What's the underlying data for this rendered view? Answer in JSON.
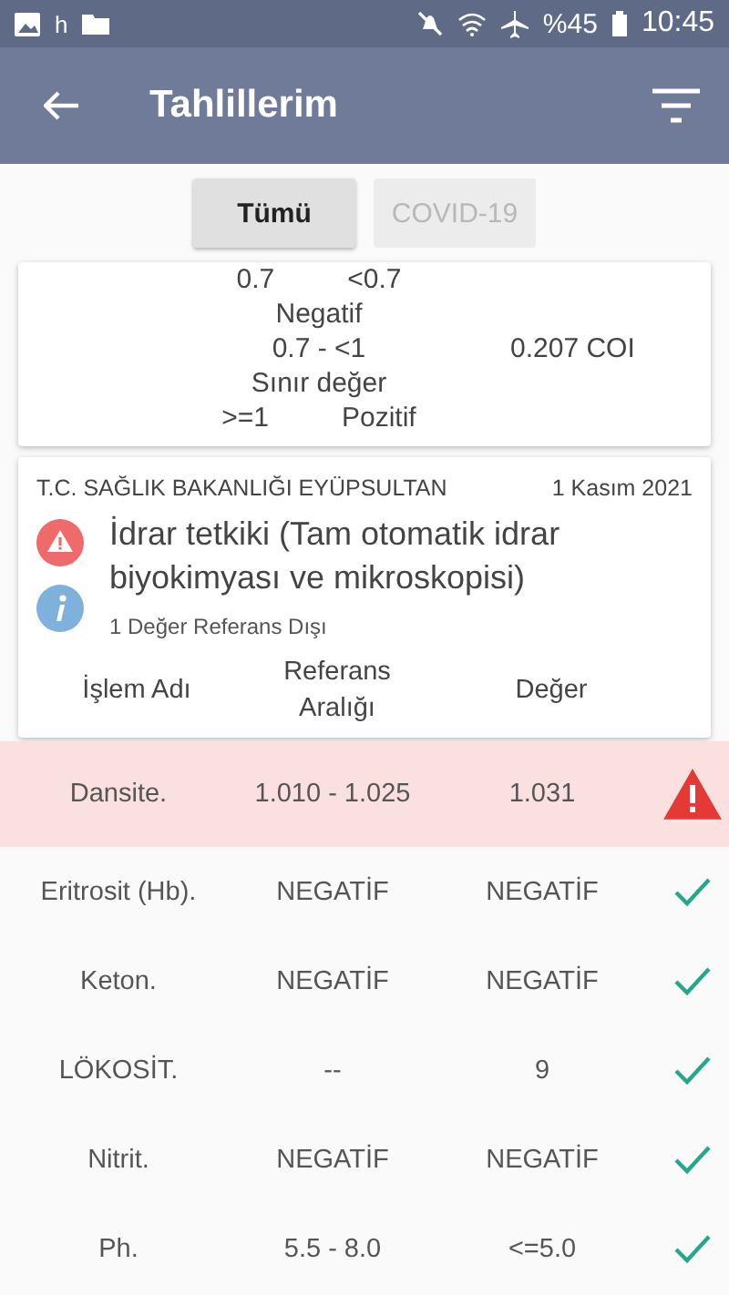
{
  "status_bar": {
    "app_letter": "h",
    "battery": "%45",
    "time": "10:45"
  },
  "app_bar": {
    "title": "Tahlillerim"
  },
  "tabs": [
    {
      "label": "Tümü",
      "selected": true
    },
    {
      "label": "COVID-19",
      "selected": false
    }
  ],
  "previous_card": {
    "reference_lines": [
      [
        "0.7",
        "<0.7"
      ],
      [
        "Negatif"
      ],
      [
        "0.7 - <1"
      ],
      [
        "Sınır değer"
      ],
      [
        ">=1",
        "Pozitif"
      ]
    ],
    "value": "0.207 COI"
  },
  "result_card": {
    "institution": "T.C. SAĞLIK BAKANLIĞI EYÜPSULTAN",
    "date": "1 Kasım 2021",
    "test_name": "İdrar tetkiki (Tam otomatik idrar biyokimyası ve mikroskopisi)",
    "summary": "1 Değer Referans Dışı",
    "columns": [
      "İşlem Adı",
      "Referans Aralığı",
      "Değer"
    ]
  },
  "rows": [
    {
      "name": "Dansite.",
      "reference": "1.010 - 1.025",
      "value": "1.031",
      "out_of_range": true
    },
    {
      "name": "Eritrosit (Hb).",
      "reference": "NEGATİF",
      "value": "NEGATİF",
      "out_of_range": false
    },
    {
      "name": "Keton.",
      "reference": "NEGATİF",
      "value": "NEGATİF",
      "out_of_range": false
    },
    {
      "name": "LÖKOSİT.",
      "reference": "--",
      "value": "9",
      "out_of_range": false
    },
    {
      "name": "Nitrit.",
      "reference": "NEGATİF",
      "value": "NEGATİF",
      "out_of_range": false
    },
    {
      "name": "Ph.",
      "reference": "5.5 - 8.0",
      "value": "<=5.0",
      "out_of_range": false
    }
  ]
}
